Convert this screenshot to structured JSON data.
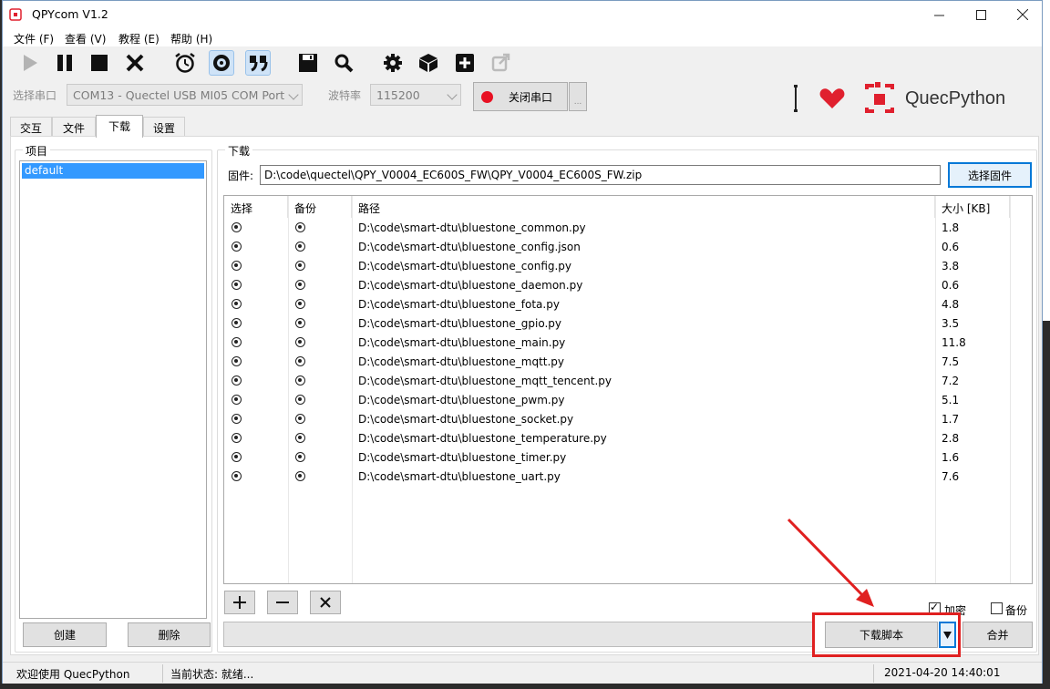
{
  "window": {
    "title": "QPYcom V1.2"
  },
  "menu": [
    "文件 (F)",
    "查看 (V)",
    "教程 (E)",
    "帮助 (H)"
  ],
  "toolbar_icons": [
    "play-icon",
    "pause-icon",
    "stop-icon",
    "close-icon",
    "alarm-clock-icon",
    "link-icon",
    "quote-icon",
    "save-icon",
    "search-icon",
    "gear-icon",
    "cube-icon",
    "plus-icon",
    "external-link-icon"
  ],
  "serial": {
    "port_label": "选择串口",
    "port_value": "COM13 - Quectel USB MI05 COM Port",
    "baud_label": "波特率",
    "baud_value": "115200",
    "close_port_label": "关闭串口",
    "extra_label": "..."
  },
  "brand": {
    "name": "QuecPython"
  },
  "tabs": [
    "交互",
    "文件",
    "下载",
    "设置"
  ],
  "projects": {
    "title": "项目",
    "items": [
      "default"
    ],
    "create_label": "创建",
    "delete_label": "删除"
  },
  "download": {
    "title": "下载",
    "firmware_label": "固件:",
    "firmware_path": "D:\\code\\quectel\\QPY_V0004_EC600S_FW\\QPY_V0004_EC600S_FW.zip",
    "choose_firmware_label": "选择固件",
    "columns": [
      "选择",
      "备份",
      "路径",
      "大小 [KB]"
    ],
    "files": [
      {
        "path": "D:\\code\\smart-dtu\\bluestone_common.py",
        "size": "1.8"
      },
      {
        "path": "D:\\code\\smart-dtu\\bluestone_config.json",
        "size": "0.6"
      },
      {
        "path": "D:\\code\\smart-dtu\\bluestone_config.py",
        "size": "3.8"
      },
      {
        "path": "D:\\code\\smart-dtu\\bluestone_daemon.py",
        "size": "0.6"
      },
      {
        "path": "D:\\code\\smart-dtu\\bluestone_fota.py",
        "size": "4.8"
      },
      {
        "path": "D:\\code\\smart-dtu\\bluestone_gpio.py",
        "size": "3.5"
      },
      {
        "path": "D:\\code\\smart-dtu\\bluestone_main.py",
        "size": "11.8"
      },
      {
        "path": "D:\\code\\smart-dtu\\bluestone_mqtt.py",
        "size": "7.5"
      },
      {
        "path": "D:\\code\\smart-dtu\\bluestone_mqtt_tencent.py",
        "size": "7.2"
      },
      {
        "path": "D:\\code\\smart-dtu\\bluestone_pwm.py",
        "size": "5.1"
      },
      {
        "path": "D:\\code\\smart-dtu\\bluestone_socket.py",
        "size": "1.7"
      },
      {
        "path": "D:\\code\\smart-dtu\\bluestone_temperature.py",
        "size": "2.8"
      },
      {
        "path": "D:\\code\\smart-dtu\\bluestone_timer.py",
        "size": "1.6"
      },
      {
        "path": "D:\\code\\smart-dtu\\bluestone_uart.py",
        "size": "7.6"
      }
    ],
    "add_label": "+",
    "remove_label": "−",
    "clear_label": "×",
    "encrypt_label": "加密",
    "encrypt_checked": true,
    "backup_label": "备份",
    "backup_checked": false,
    "download_script_label": "下载脚本",
    "merge_label": "合并"
  },
  "status": {
    "welcome": "欢迎使用 QuecPython",
    "state": "当前状态: 就绪...",
    "datetime": "2021-04-20 14:40:01"
  },
  "colors": {
    "accent_red": "#e02020",
    "selection_blue": "#3399ff",
    "brand_red": "#e0202e"
  }
}
